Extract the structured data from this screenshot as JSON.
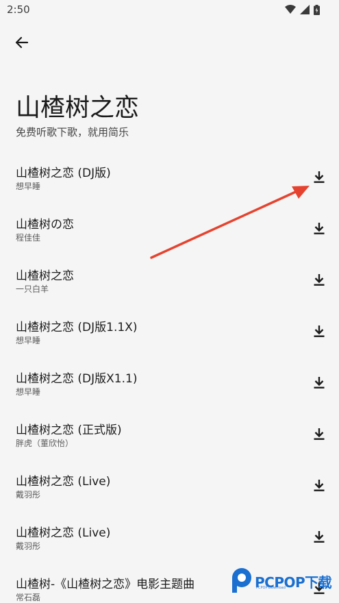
{
  "status_bar": {
    "time": "2:50"
  },
  "header": {
    "title": "山楂树之恋",
    "subtitle": "免费听歌下歌，就用简乐"
  },
  "songs": [
    {
      "title": "山楂树之恋 (DJ版)",
      "artist": "想早睡"
    },
    {
      "title": "山楂树の恋",
      "artist": "程佳佳"
    },
    {
      "title": "山楂树之恋",
      "artist": "一只白羊"
    },
    {
      "title": "山楂树之恋 (DJ版1.1X)",
      "artist": "想早睡"
    },
    {
      "title": "山楂树之恋 (DJ版X1.1)",
      "artist": "想早睡"
    },
    {
      "title": "山楂树之恋 (正式版)",
      "artist": "胖虎（董欣怡）"
    },
    {
      "title": "山楂树之恋 (Live)",
      "artist": "戴羽彤"
    },
    {
      "title": "山楂树之恋 (Live)",
      "artist": "戴羽彤"
    },
    {
      "title": "山楂树-《山楂树之恋》电影主题曲",
      "artist": "常石磊"
    }
  ],
  "watermark": {
    "text": "PCPOP下载",
    "sub": "PCPOP Download"
  },
  "icons": {
    "back": "arrow-left-icon",
    "download": "download-icon",
    "wifi": "wifi-icon",
    "signal": "signal-icon",
    "battery": "battery-icon"
  },
  "colors": {
    "background": "#f5f5f5",
    "text": "#1b1b1b",
    "annotation_arrow": "#e5432f",
    "watermark": "#1a6fd0"
  }
}
